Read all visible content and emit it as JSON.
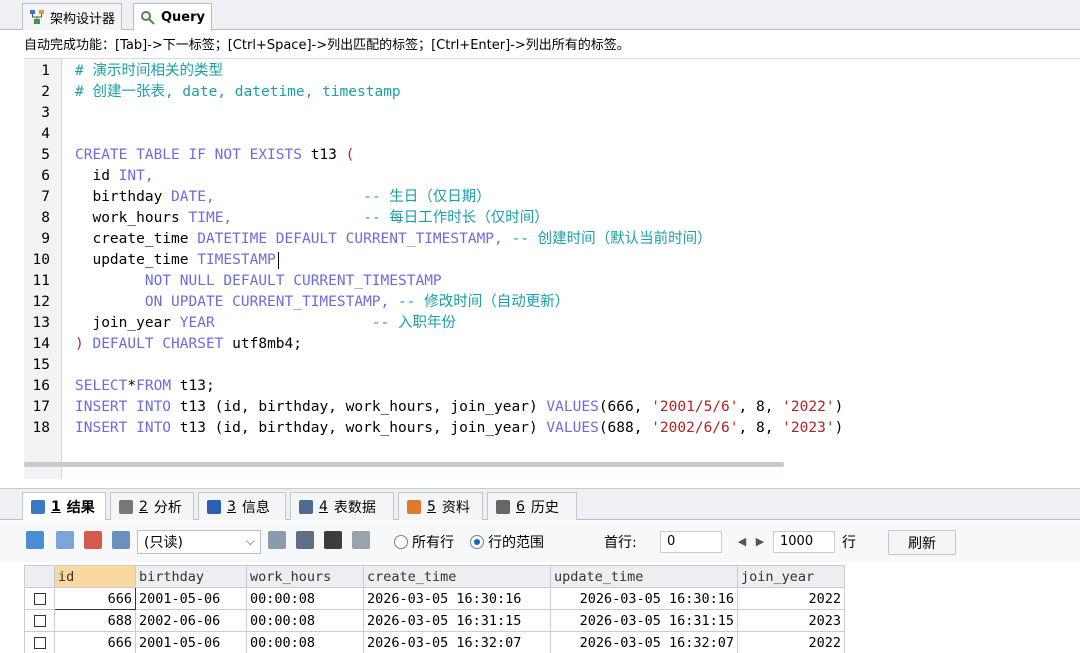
{
  "top_tabs": [
    {
      "label": "架构设计器",
      "icon": "schema-designer-icon"
    },
    {
      "label": "Query",
      "icon": "query-icon"
    }
  ],
  "autocomplete_hint": "自动完成功能：[Tab]->下一标签；[Ctrl+Space]->列出匹配的标签；[Ctrl+Enter]->列出所有的标签。",
  "editor": {
    "lines": [
      {
        "n": "1",
        "tokens": [
          {
            "t": "# 演示时间相关的类型",
            "c": "cm"
          }
        ]
      },
      {
        "n": "2",
        "tokens": [
          {
            "t": "# 创建一张表, date, datetime, timestamp",
            "c": "cm"
          }
        ]
      },
      {
        "n": "3",
        "tokens": []
      },
      {
        "n": "4",
        "tokens": []
      },
      {
        "n": "5",
        "tokens": [
          {
            "t": "CREATE TABLE IF NOT EXISTS ",
            "c": "kw"
          },
          {
            "t": "t13 ",
            "c": ""
          },
          {
            "t": "(",
            "c": "p"
          }
        ]
      },
      {
        "n": "6",
        "tokens": [
          {
            "t": "  id ",
            "c": ""
          },
          {
            "t": "INT",
            "c": "kw"
          },
          {
            "t": ",",
            "c": "kw"
          }
        ]
      },
      {
        "n": "7",
        "tokens": [
          {
            "t": "  birthday ",
            "c": ""
          },
          {
            "t": "DATE,",
            "c": "kw"
          },
          {
            "t": "                 -- 生日（仅日期）",
            "c": "cm"
          }
        ]
      },
      {
        "n": "8",
        "tokens": [
          {
            "t": "  work_hours ",
            "c": ""
          },
          {
            "t": "TIME,",
            "c": "kw"
          },
          {
            "t": "               -- 每日工作时长（仅时间）",
            "c": "cm"
          }
        ]
      },
      {
        "n": "9",
        "tokens": [
          {
            "t": "  create_time ",
            "c": ""
          },
          {
            "t": "DATETIME DEFAULT CURRENT_TIMESTAMP,",
            "c": "kw"
          },
          {
            "t": " -- 创建时间（默认当前时间）",
            "c": "cm"
          }
        ]
      },
      {
        "n": "10",
        "tokens": [
          {
            "t": "  update_time ",
            "c": ""
          },
          {
            "t": "TIMESTAMP",
            "c": "kw"
          },
          {
            "t": "",
            "c": "caret"
          }
        ]
      },
      {
        "n": "11",
        "tokens": [
          {
            "t": "        NOT NULL DEFAULT CURRENT_TIMESTAMP",
            "c": "kw"
          }
        ]
      },
      {
        "n": "12",
        "tokens": [
          {
            "t": "        ON UPDATE CURRENT_TIMESTAMP,",
            "c": "kw"
          },
          {
            "t": " -- 修改时间（自动更新）",
            "c": "cm"
          }
        ]
      },
      {
        "n": "13",
        "tokens": [
          {
            "t": "  join_year ",
            "c": ""
          },
          {
            "t": "YEAR",
            "c": "kw"
          },
          {
            "t": "                  -- 入职年份",
            "c": "cm"
          }
        ]
      },
      {
        "n": "14",
        "tokens": [
          {
            "t": ") ",
            "c": "p"
          },
          {
            "t": "DEFAULT CHARSET ",
            "c": "kw"
          },
          {
            "t": "utf8mb4;",
            "c": ""
          }
        ]
      },
      {
        "n": "15",
        "tokens": []
      },
      {
        "n": "16",
        "tokens": [
          {
            "t": "SELECT",
            "c": "kw"
          },
          {
            "t": "*",
            "c": ""
          },
          {
            "t": "FROM ",
            "c": "kw"
          },
          {
            "t": "t13;",
            "c": ""
          }
        ]
      },
      {
        "n": "17",
        "tokens": [
          {
            "t": "INSERT INTO ",
            "c": "kw"
          },
          {
            "t": "t13 (id, birthday, work_hours, join_year) ",
            "c": ""
          },
          {
            "t": "VALUES",
            "c": "kw"
          },
          {
            "t": "(666, ",
            "c": ""
          },
          {
            "t": "'2001/5/6'",
            "c": "str"
          },
          {
            "t": ", 8, ",
            "c": ""
          },
          {
            "t": "'2022'",
            "c": "str"
          },
          {
            "t": ")",
            "c": ""
          }
        ]
      },
      {
        "n": "18",
        "tokens": [
          {
            "t": "INSERT INTO ",
            "c": "kw"
          },
          {
            "t": "t13 (id, birthday, work_hours, join_year) ",
            "c": ""
          },
          {
            "t": "VALUES",
            "c": "kw"
          },
          {
            "t": "(688, ",
            "c": ""
          },
          {
            "t": "'2002/6/6'",
            "c": "str"
          },
          {
            "t": ", 8, ",
            "c": ""
          },
          {
            "t": "'2023'",
            "c": "str"
          },
          {
            "t": ")",
            "c": ""
          }
        ]
      }
    ]
  },
  "result_tabs": [
    {
      "num": "1",
      "label": "结果",
      "icon": "grid-result-icon",
      "active": true
    },
    {
      "num": "2",
      "label": "分析",
      "icon": "profiler-icon",
      "active": false
    },
    {
      "num": "3",
      "label": "信息",
      "icon": "info-icon",
      "active": false
    },
    {
      "num": "4",
      "label": "表数据",
      "icon": "table-data-icon",
      "active": false
    },
    {
      "num": "5",
      "label": "资料",
      "icon": "chart-icon",
      "active": false
    },
    {
      "num": "6",
      "label": "历史",
      "icon": "history-icon",
      "active": false
    }
  ],
  "toolbar": {
    "mode_select": "(只读)",
    "radio_all_rows": "所有行",
    "radio_row_range": "行的范围",
    "first_row_label": "首行:",
    "first_row_value": "0",
    "row_count_value": "1000",
    "rows_label": "行",
    "refresh_label": "刷新"
  },
  "results": {
    "columns": [
      "id",
      "birthday",
      "work_hours",
      "create_time",
      "update_time",
      "join_year"
    ],
    "rows": [
      [
        "666",
        "2001-05-06",
        "00:00:08",
        "2026-03-05 16:30:16",
        "2026-03-05 16:30:16",
        "2022"
      ],
      [
        "688",
        "2002-06-06",
        "00:00:08",
        "2026-03-05 16:31:15",
        "2026-03-05 16:31:15",
        "2023"
      ],
      [
        "666",
        "2001-05-06",
        "00:00:08",
        "2026-03-05 16:32:07",
        "2026-03-05 16:32:07",
        "2022"
      ]
    ]
  }
}
